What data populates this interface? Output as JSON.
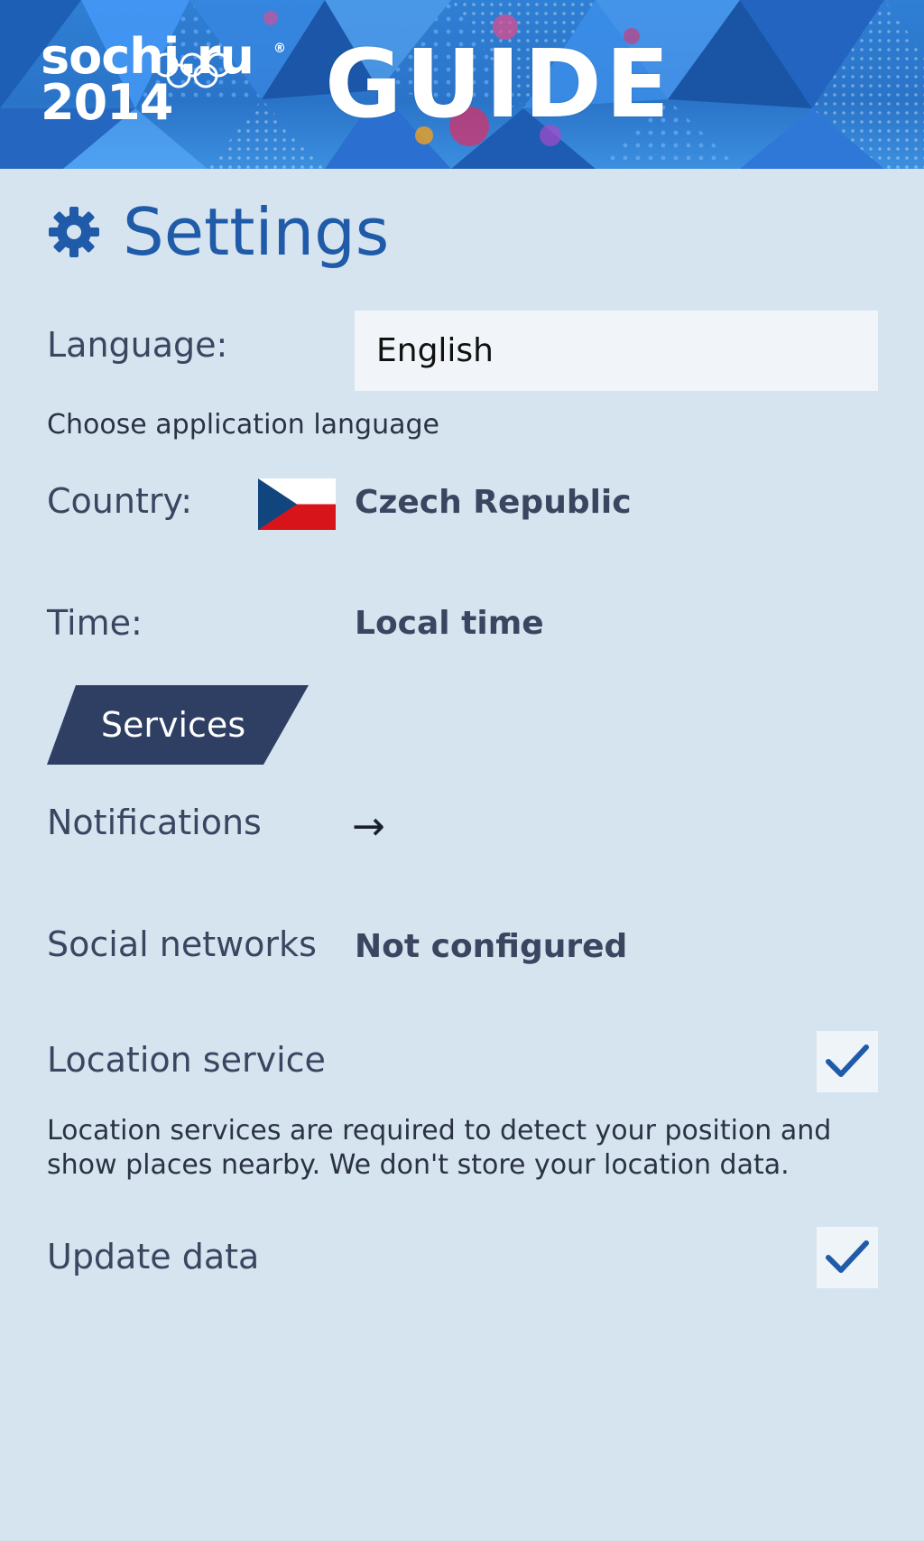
{
  "header": {
    "logo_line1": "sochi.ru",
    "logo_line2": "2014",
    "logo_reg": "®",
    "app_title": "GUIDE"
  },
  "settings": {
    "title": "Settings",
    "language": {
      "label": "Language:",
      "value": "English",
      "hint": "Choose application language"
    },
    "country": {
      "label": "Country:",
      "value": "Czech Republic"
    },
    "time": {
      "label": "Time:",
      "value": "Local time"
    },
    "services_tab": "Services",
    "notifications": {
      "label": "Notifications",
      "arrow": "→"
    },
    "social": {
      "label": "Social networks",
      "value": "Not configured"
    },
    "location": {
      "label": "Location service",
      "checked": true,
      "description_line1": "Location services are required to detect your position and",
      "description_line2": "show places nearby. We don't store your location data."
    },
    "update": {
      "label": "Update data",
      "checked": true
    }
  },
  "colors": {
    "background": "#d6e4f0",
    "accent": "#1f5ba8",
    "tab": "#2e3f63",
    "text": "#3a4660"
  },
  "icons": [
    "gear-icon",
    "czech-flag-icon",
    "arrow-right-icon",
    "checkmark-icon",
    "olympic-rings-icon"
  ]
}
